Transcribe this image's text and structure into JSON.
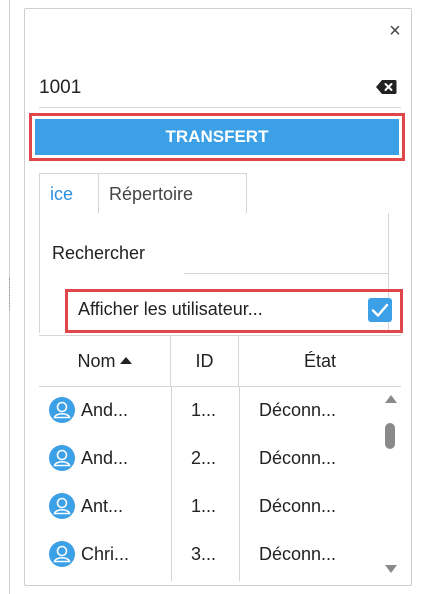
{
  "panel": {
    "close_icon": "×",
    "dial_number": "1001",
    "transfer_label": "TRANSFERT"
  },
  "tabs": [
    {
      "label": "ice",
      "active": true
    },
    {
      "label": "Répertoire",
      "active": false
    }
  ],
  "search": {
    "label": "Rechercher",
    "value": ""
  },
  "show_users": {
    "label": "Afficher les utilisateur...",
    "checked": true
  },
  "table": {
    "columns": [
      "Nom",
      "ID",
      "État"
    ],
    "sort_column": "Nom",
    "sort_direction": "ascending",
    "rows": [
      {
        "name": "And...",
        "id": "1...",
        "state": "Déconn..."
      },
      {
        "name": "And...",
        "id": "2...",
        "state": "Déconn..."
      },
      {
        "name": "Ant...",
        "id": "1...",
        "state": "Déconn..."
      },
      {
        "name": "Chri...",
        "id": "3...",
        "state": "Déconn..."
      }
    ]
  },
  "colors": {
    "accent": "#3ba0e6",
    "highlight": "#e0464a"
  },
  "icons": [
    "close-icon",
    "backspace-icon",
    "sort-ascending-icon",
    "user-icon",
    "check-icon"
  ]
}
